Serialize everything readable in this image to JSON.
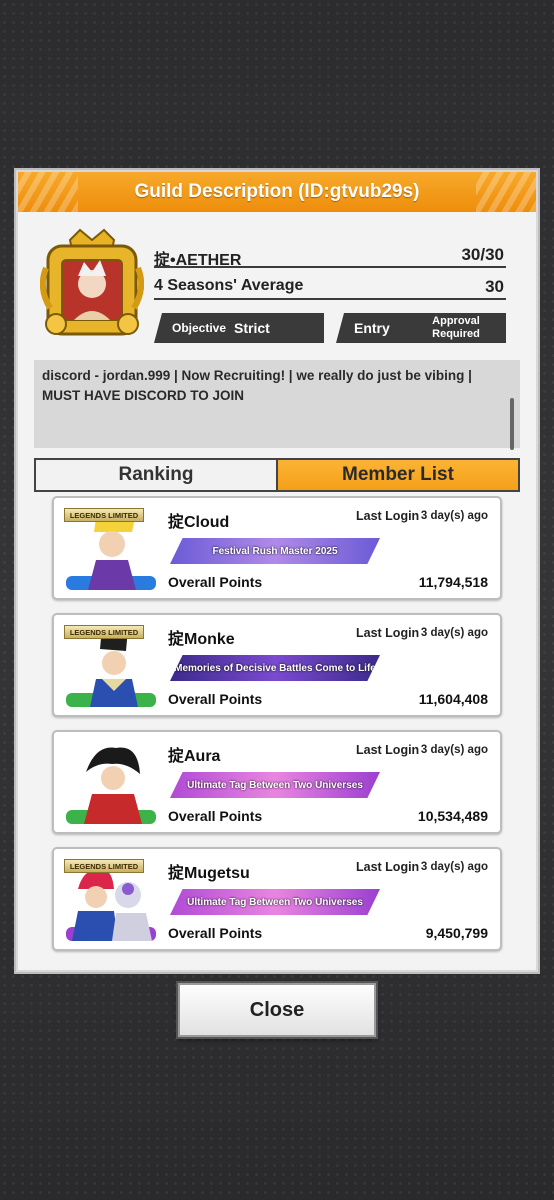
{
  "header": {
    "title": "Guild Description (ID:gtvub29s)"
  },
  "guild": {
    "name": "掟•AETHER",
    "member_count": "30/30",
    "seasons_label": "4 Seasons' Average",
    "seasons_value": "30",
    "objective_label": "Objective",
    "objective_value": "Strict",
    "entry_label": "Entry",
    "entry_value": "Approval Required",
    "description": "discord - jordan.999 | Now Recruiting! | we really do just be vibing | MUST HAVE DISCORD TO JOIN"
  },
  "tabs": {
    "ranking": "Ranking",
    "member_list": "Member List"
  },
  "members": [
    {
      "badge": "LEGENDS LIMITED",
      "name": "掟Cloud",
      "last_login_label": "Last Login",
      "last_login": "3 day(s) ago",
      "title": "Festival Rush Master 2025",
      "points_label": "Overall Points",
      "points": "11,794,518",
      "accent": "#2a7be0"
    },
    {
      "badge": "LEGENDS LIMITED",
      "name": "掟Monke",
      "last_login_label": "Last Login",
      "last_login": "3 day(s) ago",
      "title": "Memories of Decisive Battles Come to Life",
      "points_label": "Overall Points",
      "points": "11,604,408",
      "accent": "#3bb24a"
    },
    {
      "badge": "",
      "name": "掟Aura",
      "last_login_label": "Last Login",
      "last_login": "3 day(s) ago",
      "title": "Ultimate Tag Between Two Universes",
      "points_label": "Overall Points",
      "points": "10,534,489",
      "accent": "#3bb24a"
    },
    {
      "badge": "LEGENDS LIMITED",
      "name": "掟Mugetsu",
      "last_login_label": "Last Login",
      "last_login": "3 day(s) ago",
      "title": "Ultimate Tag Between Two Universes",
      "points_label": "Overall Points",
      "points": "9,450,799",
      "accent": "#9a3fd0"
    }
  ],
  "buttons": {
    "close": "Close"
  },
  "colors": {
    "header_orange": "#f39a1a",
    "tab_active": "#f6a821",
    "panel_bg": "#f3f3f3",
    "dark_tag": "#3a3a3a"
  }
}
